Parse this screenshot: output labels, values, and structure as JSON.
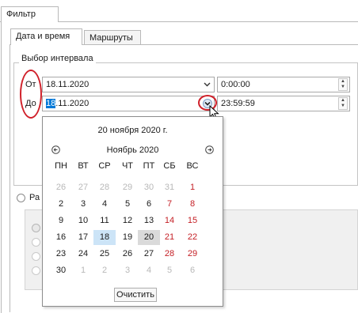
{
  "outer_tab": {
    "label": "Фильтр"
  },
  "inner_tabs": [
    {
      "label": "Дата и время",
      "active": true
    },
    {
      "label": "Маршруты",
      "active": false
    }
  ],
  "interval_group": {
    "legend": "Выбор интервала"
  },
  "from_row": {
    "label": "От",
    "date": "18.11.2020",
    "time": "0:00:00"
  },
  "to_row": {
    "label": "До",
    "date_selected": "18",
    "date_rest": ".11.2020",
    "time": "23:59:59"
  },
  "radio_option": {
    "label": "Ра"
  },
  "calendar": {
    "today_caption": "20 ноября 2020 г.",
    "month_label": "Ноябрь 2020",
    "weekdays": [
      "ПН",
      "ВТ",
      "СР",
      "ЧТ",
      "ПТ",
      "СБ",
      "ВС"
    ],
    "weeks": [
      [
        "26",
        "27",
        "28",
        "29",
        "30",
        "31",
        "1"
      ],
      [
        "2",
        "3",
        "4",
        "5",
        "6",
        "7",
        "8"
      ],
      [
        "9",
        "10",
        "11",
        "12",
        "13",
        "14",
        "15"
      ],
      [
        "16",
        "17",
        "18",
        "19",
        "20",
        "21",
        "22"
      ],
      [
        "23",
        "24",
        "25",
        "26",
        "27",
        "28",
        "29"
      ],
      [
        "30",
        "1",
        "2",
        "3",
        "4",
        "5",
        "6"
      ]
    ],
    "clear_label": "Очистить",
    "selected_day": "18",
    "today_day": "20"
  },
  "colors": {
    "accent": "#0078d7",
    "weekend": "#c41e24",
    "annotation": "#d0212b",
    "selected_bg": "#cce4f7"
  },
  "icons": {
    "prev_month": "circle-arrow-left-icon",
    "next_month": "circle-arrow-right-icon",
    "dropdown": "chevron-down-icon",
    "cursor": "mouse-pointer-icon"
  }
}
